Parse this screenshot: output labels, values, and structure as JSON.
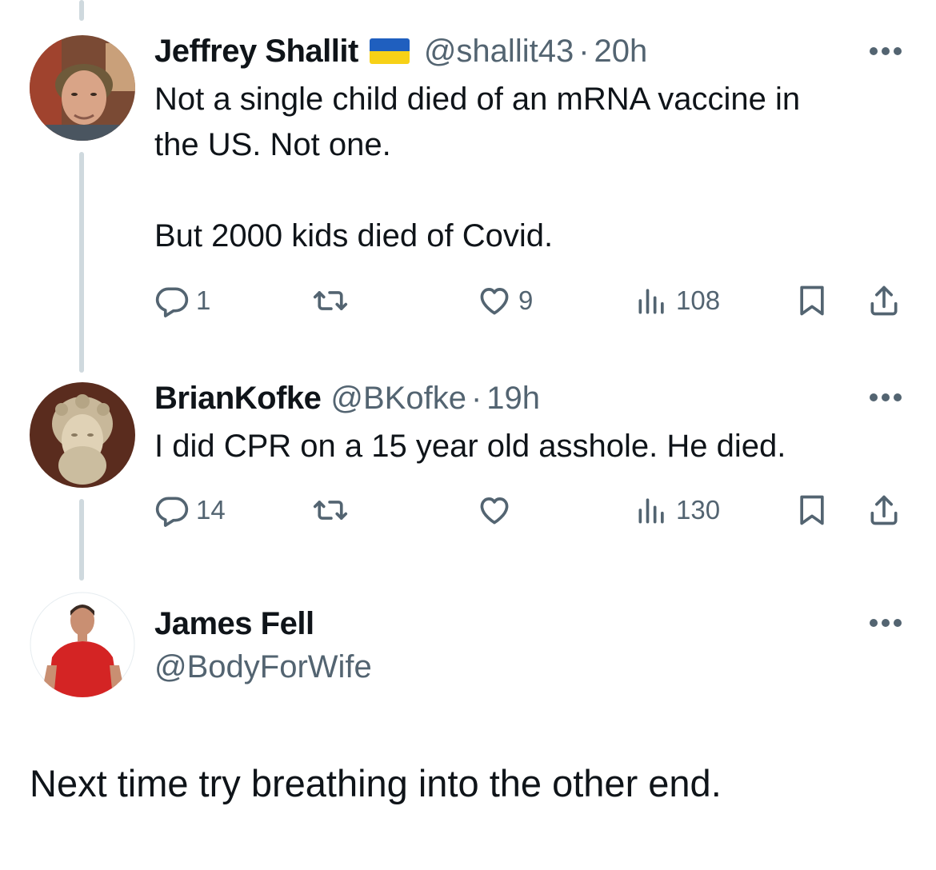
{
  "tweets": [
    {
      "display_name": "Jeffrey Shallit",
      "handle": "@shallit43",
      "separator": "·",
      "time": "20h",
      "text": "Not a single child died of an mRNA vaccine in\nthe US.  Not one.\n\nBut 2000 kids died of Covid.",
      "badge_icon": "ukraine-flag-icon",
      "avatar_icon": "avatar-photo-man-curly-hair",
      "actions": {
        "reply_count": "1",
        "retweet_count": "",
        "like_count": "9",
        "view_count": "108"
      }
    },
    {
      "display_name": "BrianKofke",
      "handle": "@BKofke",
      "separator": "·",
      "time": "19h",
      "text": "I did CPR on a 15 year old asshole.  He died.",
      "avatar_icon": "avatar-photo-marble-bust",
      "actions": {
        "reply_count": "14",
        "retweet_count": "",
        "like_count": "",
        "view_count": "130"
      }
    }
  ],
  "reply": {
    "display_name": "James Fell",
    "handle": "@BodyForWife",
    "text": "Next time try breathing into the other end.",
    "avatar_icon": "avatar-photo-man-red-shirt"
  },
  "colors": {
    "text_primary": "#0f1419",
    "text_secondary": "#536471",
    "thread_line": "#cfd9de",
    "flag_blue": "#1f5fbf",
    "flag_yellow": "#f7d117"
  },
  "icons": {
    "reply": "reply-icon",
    "retweet": "retweet-icon",
    "like": "heart-icon",
    "views": "views-chart-icon",
    "bookmark": "bookmark-icon",
    "share": "share-icon",
    "more": "more-dots-icon"
  }
}
